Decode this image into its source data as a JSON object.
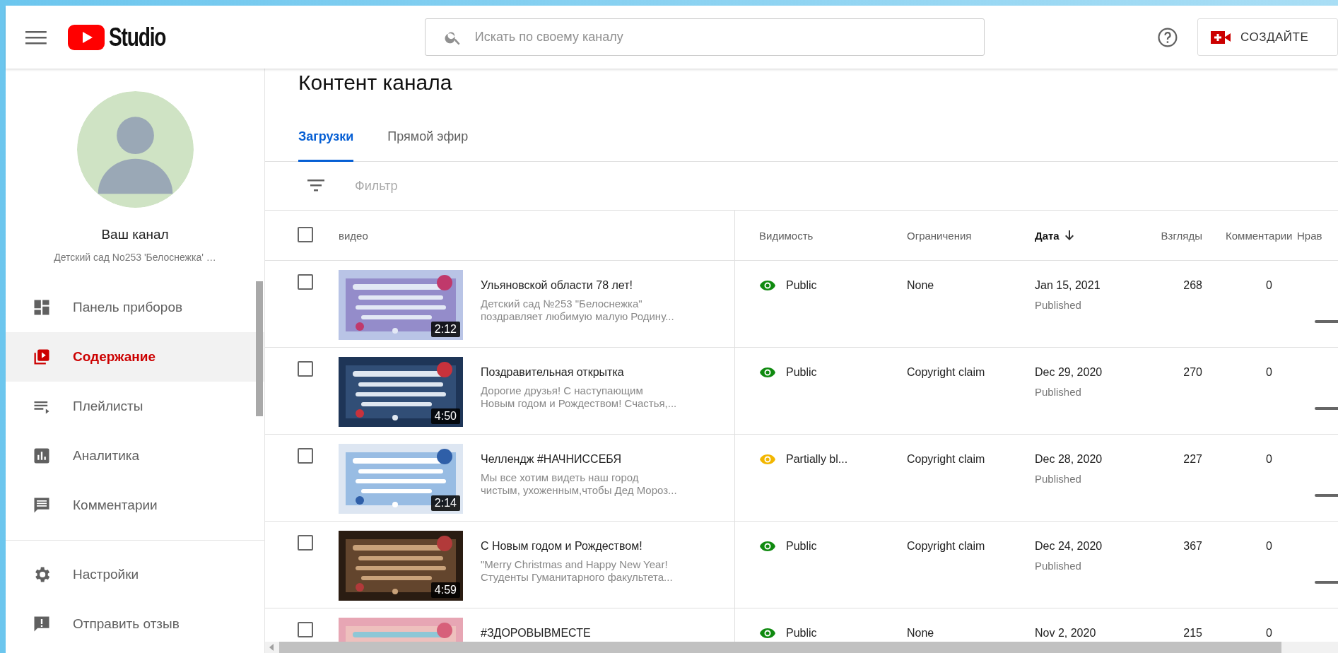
{
  "header": {
    "logo_text": "Studio",
    "search": {
      "placeholder": "Искать по своему каналу"
    },
    "create_button": "СОЗДАЙТЕ"
  },
  "sidebar": {
    "channel_title": "Ваш канал",
    "channel_subtitle": "Детский сад No253 'Белоснежка' …",
    "items": [
      {
        "kind": "dashboard",
        "label": "Панель приборов",
        "selected": false
      },
      {
        "kind": "content",
        "label": "Содержание",
        "selected": true
      },
      {
        "kind": "playlists",
        "label": "Плейлисты",
        "selected": false
      },
      {
        "kind": "analytics",
        "label": "Аналитика",
        "selected": false
      },
      {
        "kind": "comments",
        "label": "Комментарии",
        "selected": false
      }
    ],
    "footer_items": [
      {
        "kind": "settings",
        "label": "Настройки",
        "selected": false
      },
      {
        "kind": "feedback",
        "label": "Отправить отзыв",
        "selected": false
      }
    ]
  },
  "page_title": "Контент канала",
  "tabs": [
    {
      "label": "Загрузки",
      "selected": true
    },
    {
      "label": "Прямой эфир",
      "selected": false
    }
  ],
  "filter": {
    "placeholder": "Фильтр"
  },
  "table": {
    "select_all_checked": false,
    "columns": [
      {
        "label": "видео",
        "sorted": false
      },
      {
        "label": "Видимость",
        "sorted": false
      },
      {
        "label": "Ограничения",
        "sorted": false
      },
      {
        "label": "Дата",
        "sorted": true
      },
      {
        "label": "Взгляды",
        "sorted": false
      },
      {
        "label": "Комментарии",
        "sorted": false
      },
      {
        "label": "Нрав",
        "sorted": false
      }
    ],
    "rows": [
      {
        "checked": false,
        "duration": "2:12",
        "title": "Ульяновской области 78 лет!",
        "description": "Детский сад №253 \"Белоснежка\" поздравляет любимую малую Родину...",
        "visibility": {
          "kind": "public",
          "label": "Public"
        },
        "restrictions": "None",
        "date": "Jan 15, 2021",
        "status": "Published",
        "views": "268",
        "comments": "0"
      },
      {
        "checked": false,
        "duration": "4:50",
        "title": "Поздравительная открытка",
        "description": "Дорогие друзья! С наступающим Новым годом и Рождеством! Счастья,...",
        "visibility": {
          "kind": "public",
          "label": "Public"
        },
        "restrictions": "Copyright claim",
        "date": "Dec 29, 2020",
        "status": "Published",
        "views": "270",
        "comments": "0"
      },
      {
        "checked": false,
        "duration": "2:14",
        "title": "Челлендж #НАЧНИССЕБЯ",
        "description": "Мы все хотим видеть наш город чистым, ухоженным,чтобы Дед Мороз...",
        "visibility": {
          "kind": "partial",
          "label": "Partially bl..."
        },
        "restrictions": "Copyright claim",
        "date": "Dec 28, 2020",
        "status": "Published",
        "views": "227",
        "comments": "0"
      },
      {
        "checked": false,
        "duration": "4:59",
        "title": "С Новым годом и Рождеством!",
        "description": "\"Merry Christmas and Happy New Year! Студенты Гуманитарного факультета...",
        "visibility": {
          "kind": "public",
          "label": "Public"
        },
        "restrictions": "Copyright claim",
        "date": "Dec 24, 2020",
        "status": "Published",
        "views": "367",
        "comments": "0"
      },
      {
        "checked": false,
        "title": "#ЗДОРОВЫВМЕСТЕ",
        "visibility": {
          "kind": "public",
          "label": "Public"
        },
        "restrictions": "None",
        "date": "Nov 2, 2020",
        "views": "215",
        "comments": "0"
      }
    ]
  }
}
